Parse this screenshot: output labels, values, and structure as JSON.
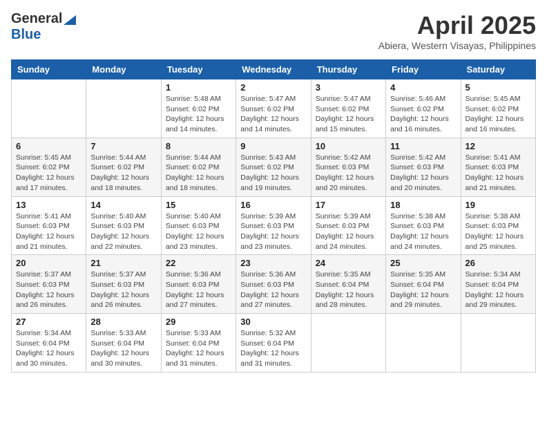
{
  "header": {
    "logo_general": "General",
    "logo_blue": "Blue",
    "month_title": "April 2025",
    "location": "Abiera, Western Visayas, Philippines"
  },
  "calendar": {
    "days_of_week": [
      "Sunday",
      "Monday",
      "Tuesday",
      "Wednesday",
      "Thursday",
      "Friday",
      "Saturday"
    ],
    "weeks": [
      [
        {
          "day": "",
          "info": ""
        },
        {
          "day": "",
          "info": ""
        },
        {
          "day": "1",
          "info": "Sunrise: 5:48 AM\nSunset: 6:02 PM\nDaylight: 12 hours and 14 minutes."
        },
        {
          "day": "2",
          "info": "Sunrise: 5:47 AM\nSunset: 6:02 PM\nDaylight: 12 hours and 14 minutes."
        },
        {
          "day": "3",
          "info": "Sunrise: 5:47 AM\nSunset: 6:02 PM\nDaylight: 12 hours and 15 minutes."
        },
        {
          "day": "4",
          "info": "Sunrise: 5:46 AM\nSunset: 6:02 PM\nDaylight: 12 hours and 16 minutes."
        },
        {
          "day": "5",
          "info": "Sunrise: 5:45 AM\nSunset: 6:02 PM\nDaylight: 12 hours and 16 minutes."
        }
      ],
      [
        {
          "day": "6",
          "info": "Sunrise: 5:45 AM\nSunset: 6:02 PM\nDaylight: 12 hours and 17 minutes."
        },
        {
          "day": "7",
          "info": "Sunrise: 5:44 AM\nSunset: 6:02 PM\nDaylight: 12 hours and 18 minutes."
        },
        {
          "day": "8",
          "info": "Sunrise: 5:44 AM\nSunset: 6:02 PM\nDaylight: 12 hours and 18 minutes."
        },
        {
          "day": "9",
          "info": "Sunrise: 5:43 AM\nSunset: 6:02 PM\nDaylight: 12 hours and 19 minutes."
        },
        {
          "day": "10",
          "info": "Sunrise: 5:42 AM\nSunset: 6:03 PM\nDaylight: 12 hours and 20 minutes."
        },
        {
          "day": "11",
          "info": "Sunrise: 5:42 AM\nSunset: 6:03 PM\nDaylight: 12 hours and 20 minutes."
        },
        {
          "day": "12",
          "info": "Sunrise: 5:41 AM\nSunset: 6:03 PM\nDaylight: 12 hours and 21 minutes."
        }
      ],
      [
        {
          "day": "13",
          "info": "Sunrise: 5:41 AM\nSunset: 6:03 PM\nDaylight: 12 hours and 21 minutes."
        },
        {
          "day": "14",
          "info": "Sunrise: 5:40 AM\nSunset: 6:03 PM\nDaylight: 12 hours and 22 minutes."
        },
        {
          "day": "15",
          "info": "Sunrise: 5:40 AM\nSunset: 6:03 PM\nDaylight: 12 hours and 23 minutes."
        },
        {
          "day": "16",
          "info": "Sunrise: 5:39 AM\nSunset: 6:03 PM\nDaylight: 12 hours and 23 minutes."
        },
        {
          "day": "17",
          "info": "Sunrise: 5:39 AM\nSunset: 6:03 PM\nDaylight: 12 hours and 24 minutes."
        },
        {
          "day": "18",
          "info": "Sunrise: 5:38 AM\nSunset: 6:03 PM\nDaylight: 12 hours and 24 minutes."
        },
        {
          "day": "19",
          "info": "Sunrise: 5:38 AM\nSunset: 6:03 PM\nDaylight: 12 hours and 25 minutes."
        }
      ],
      [
        {
          "day": "20",
          "info": "Sunrise: 5:37 AM\nSunset: 6:03 PM\nDaylight: 12 hours and 26 minutes."
        },
        {
          "day": "21",
          "info": "Sunrise: 5:37 AM\nSunset: 6:03 PM\nDaylight: 12 hours and 26 minutes."
        },
        {
          "day": "22",
          "info": "Sunrise: 5:36 AM\nSunset: 6:03 PM\nDaylight: 12 hours and 27 minutes."
        },
        {
          "day": "23",
          "info": "Sunrise: 5:36 AM\nSunset: 6:03 PM\nDaylight: 12 hours and 27 minutes."
        },
        {
          "day": "24",
          "info": "Sunrise: 5:35 AM\nSunset: 6:04 PM\nDaylight: 12 hours and 28 minutes."
        },
        {
          "day": "25",
          "info": "Sunrise: 5:35 AM\nSunset: 6:04 PM\nDaylight: 12 hours and 29 minutes."
        },
        {
          "day": "26",
          "info": "Sunrise: 5:34 AM\nSunset: 6:04 PM\nDaylight: 12 hours and 29 minutes."
        }
      ],
      [
        {
          "day": "27",
          "info": "Sunrise: 5:34 AM\nSunset: 6:04 PM\nDaylight: 12 hours and 30 minutes."
        },
        {
          "day": "28",
          "info": "Sunrise: 5:33 AM\nSunset: 6:04 PM\nDaylight: 12 hours and 30 minutes."
        },
        {
          "day": "29",
          "info": "Sunrise: 5:33 AM\nSunset: 6:04 PM\nDaylight: 12 hours and 31 minutes."
        },
        {
          "day": "30",
          "info": "Sunrise: 5:32 AM\nSunset: 6:04 PM\nDaylight: 12 hours and 31 minutes."
        },
        {
          "day": "",
          "info": ""
        },
        {
          "day": "",
          "info": ""
        },
        {
          "day": "",
          "info": ""
        }
      ]
    ]
  }
}
